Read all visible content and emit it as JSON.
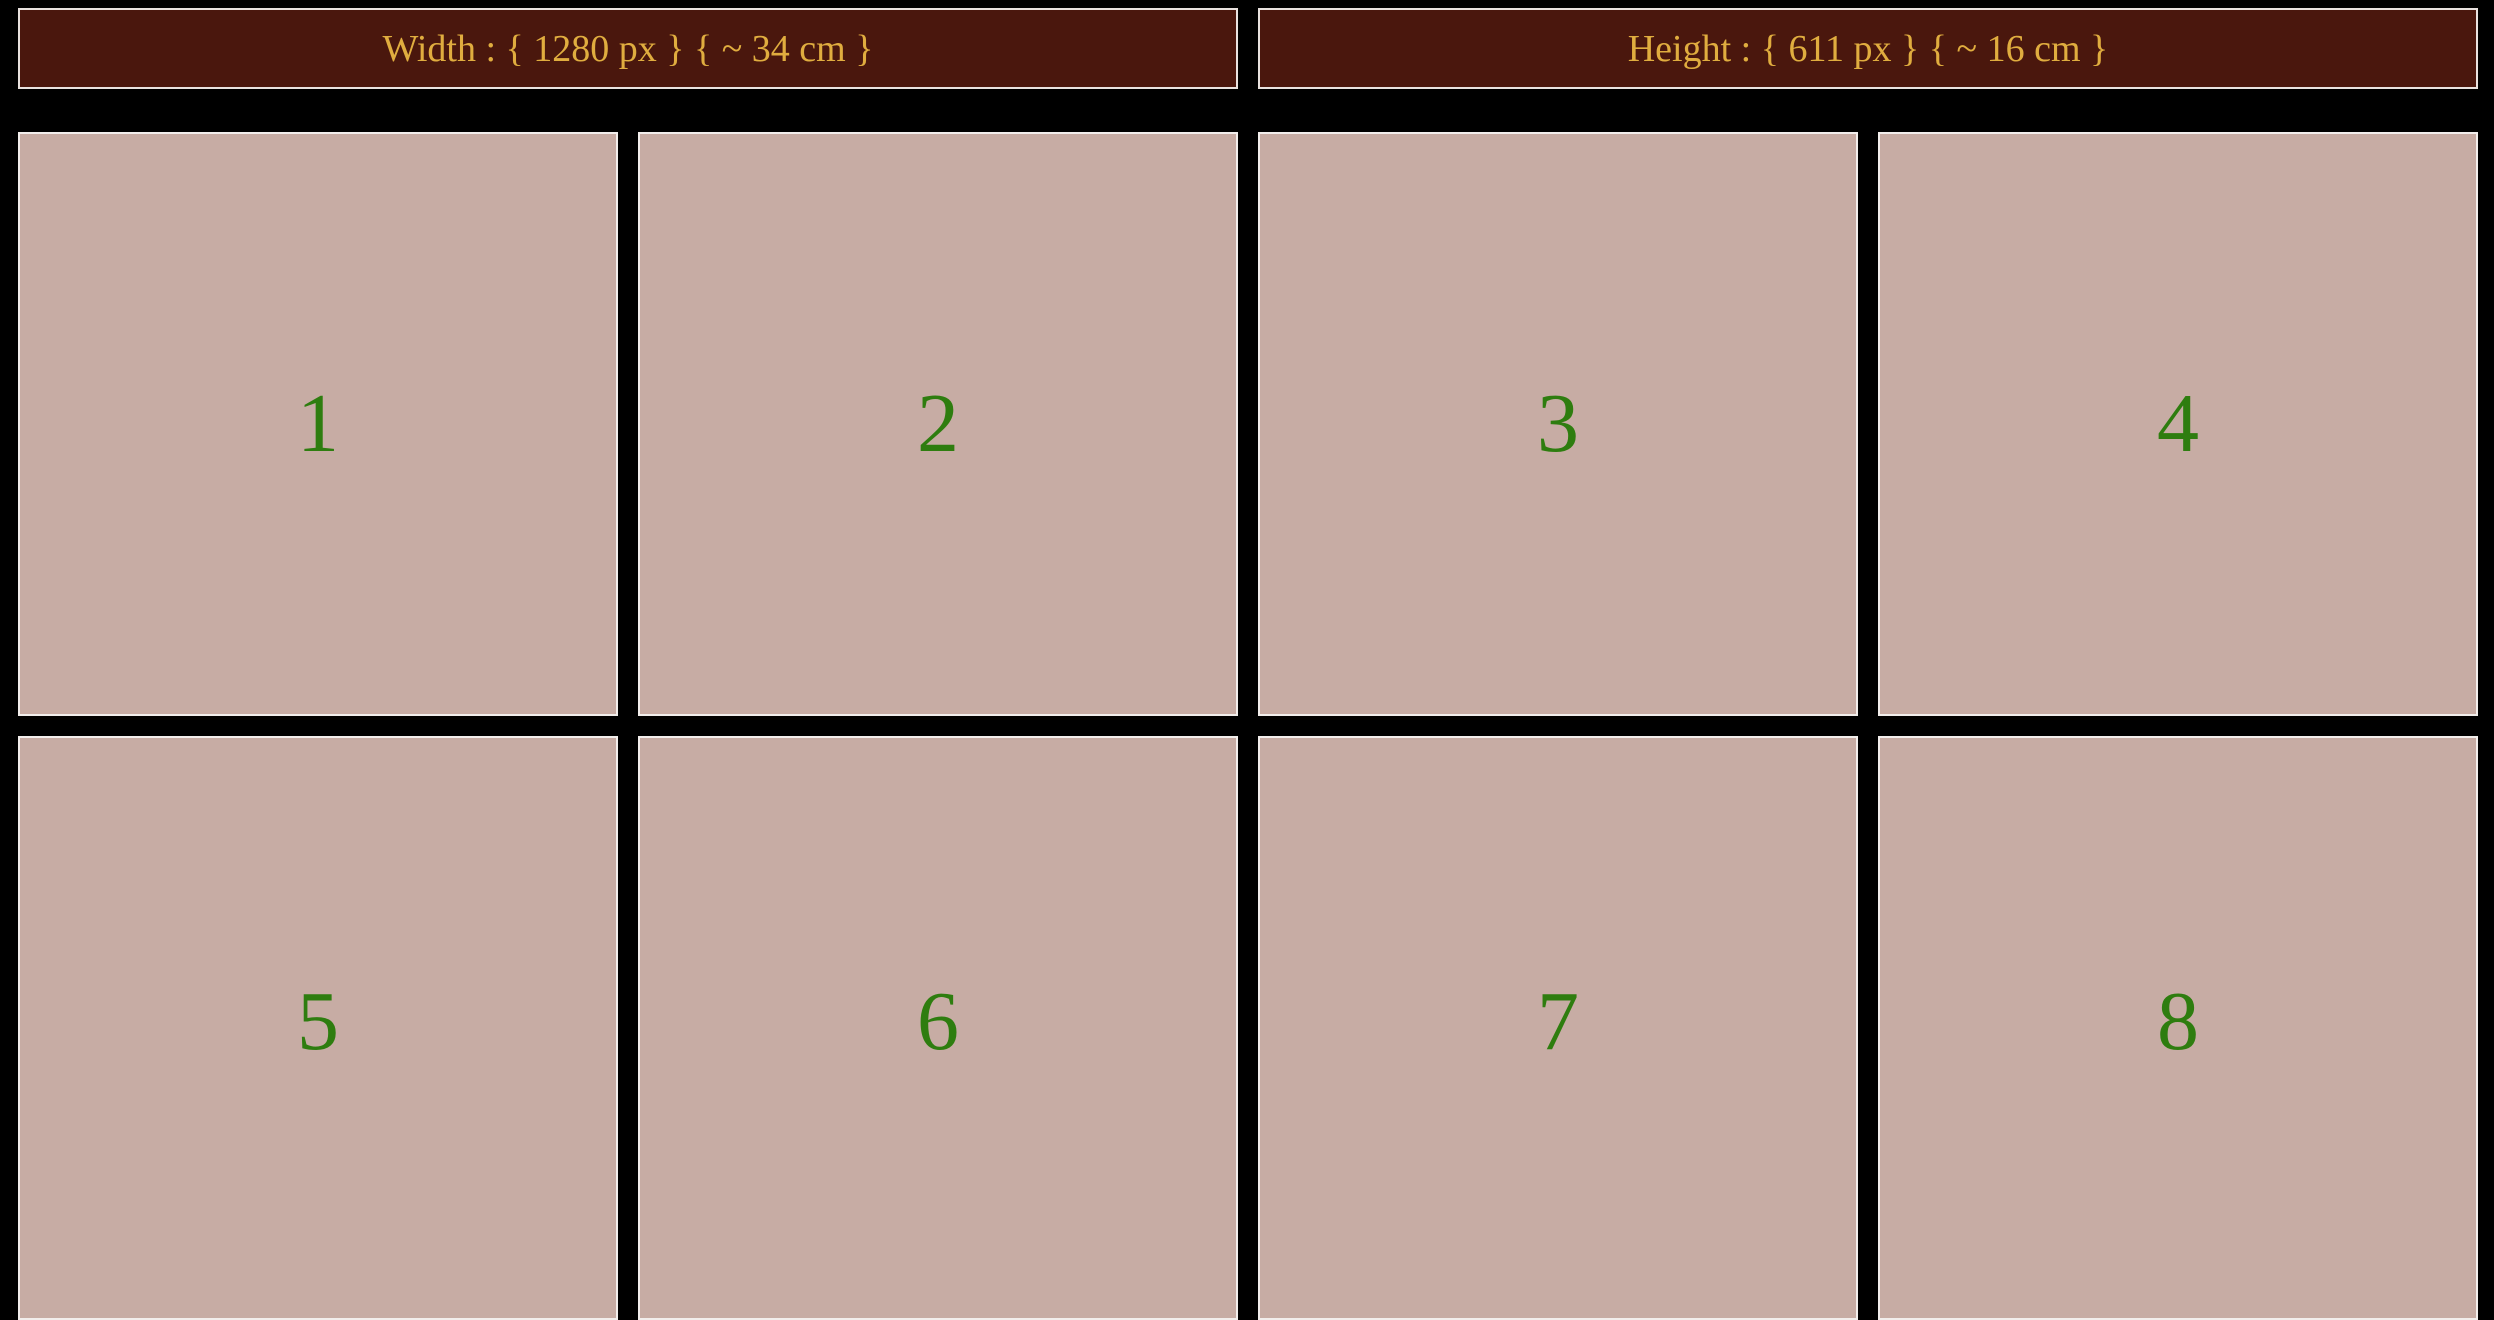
{
  "header": {
    "width_label": "Width : { 1280 px } { ~ 34 cm }",
    "height_label": "Height : { 611 px } { ~ 16 cm }"
  },
  "tiles": [
    {
      "label": "1"
    },
    {
      "label": "2"
    },
    {
      "label": "3"
    },
    {
      "label": "4"
    },
    {
      "label": "5"
    },
    {
      "label": "6"
    },
    {
      "label": "7"
    },
    {
      "label": "8"
    }
  ],
  "colors": {
    "background": "#000000",
    "header_background": "#4a170d",
    "header_text": "#e0ad3f",
    "tile_background": "#c7aca4",
    "tile_number": "#2e7d0f",
    "border": "#f2eeec"
  }
}
